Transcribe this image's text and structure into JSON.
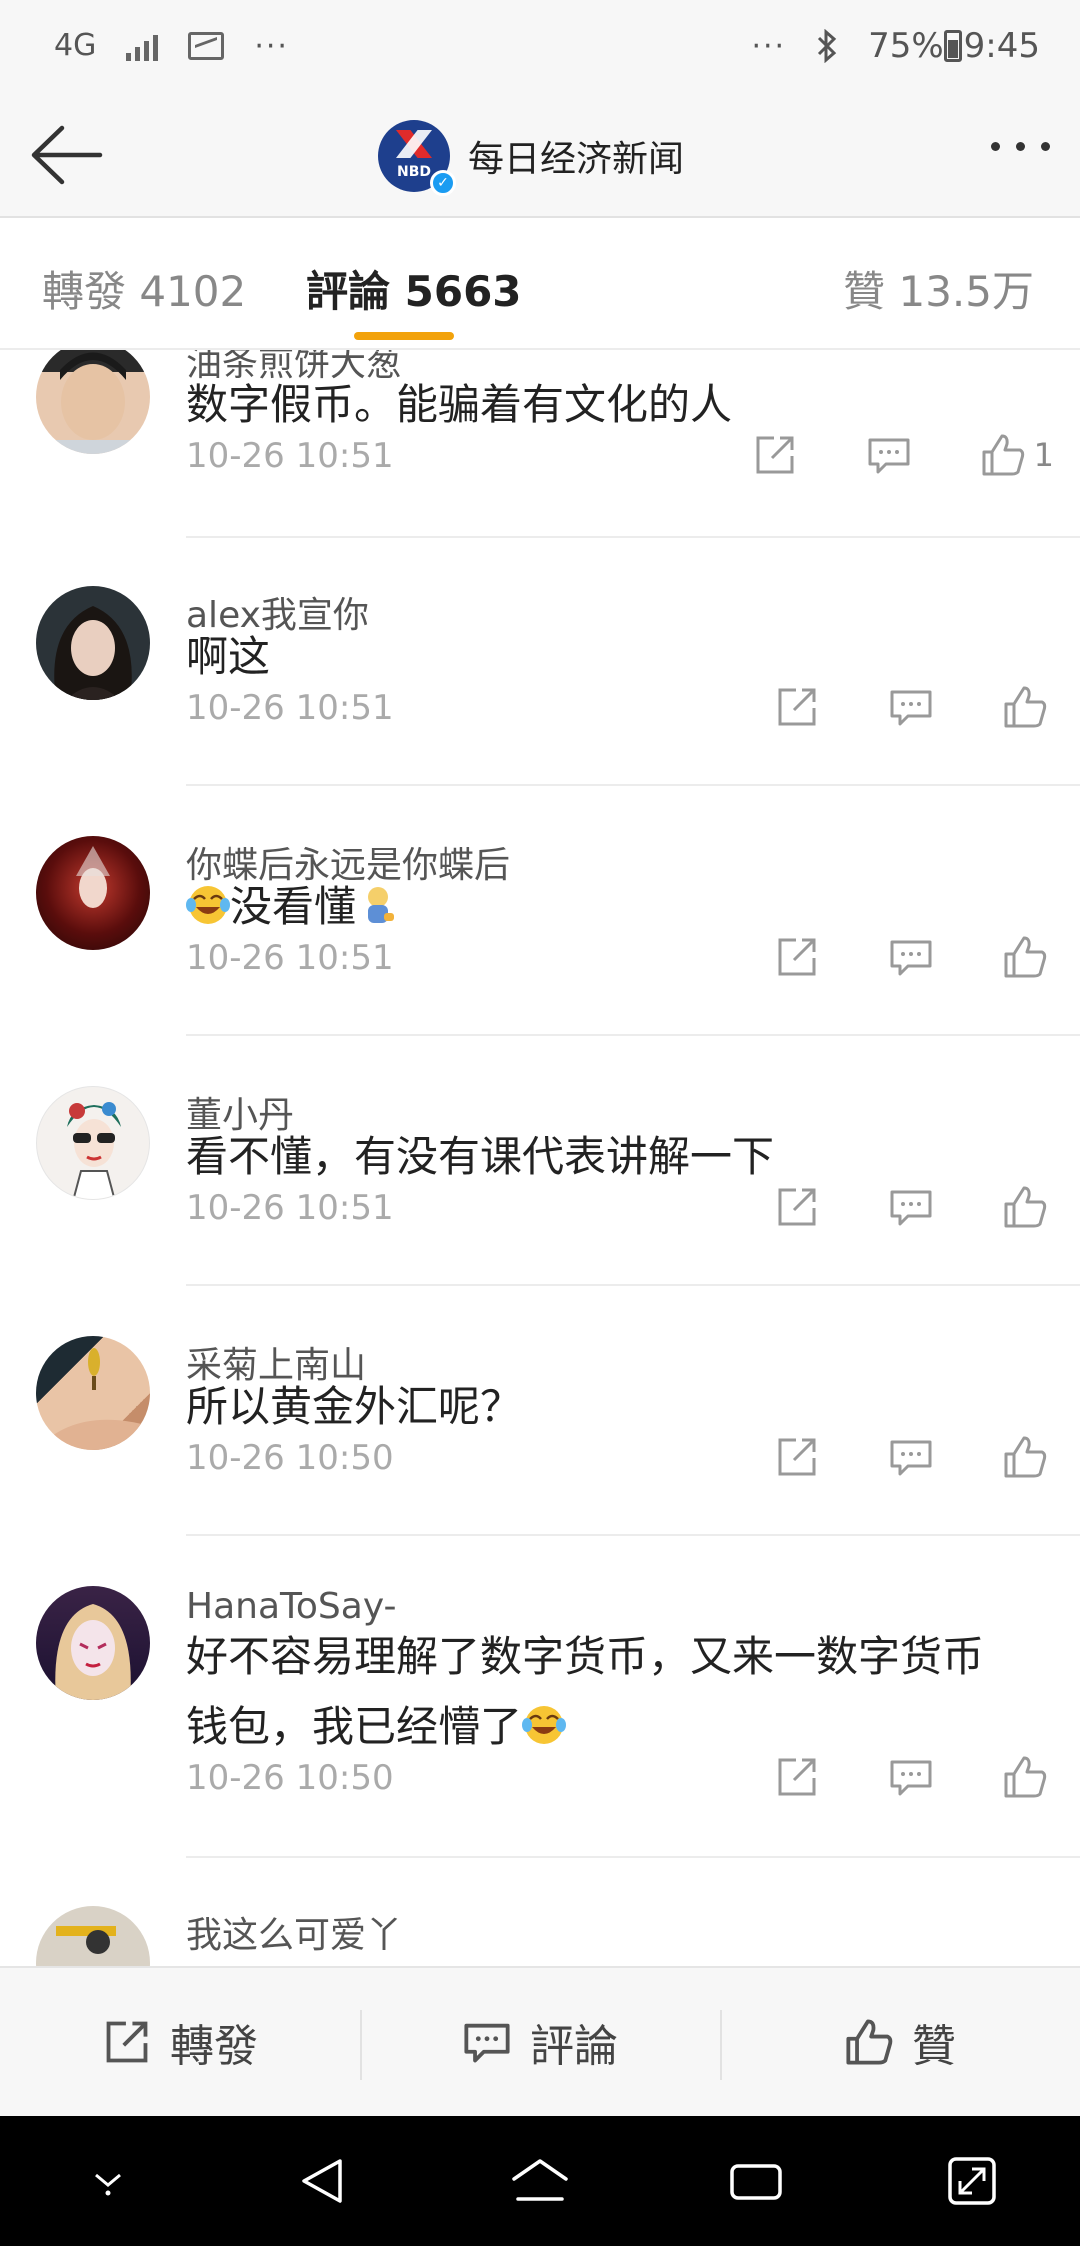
{
  "status_bar": {
    "network": "4G",
    "dots_left": "···",
    "dots_right": "···",
    "battery": "75%",
    "time": "9:45"
  },
  "header": {
    "logo_text": "NBD",
    "title": "每日经济新闻"
  },
  "tabs": {
    "repost": "轉發 4102",
    "comment": "評論 5663",
    "like": "贊 13.5万",
    "accent_color": "#f2a20b"
  },
  "comments": [
    {
      "user": "油条煎饼大葱",
      "text": "数字假币。能骗着有文化的人",
      "time": "10-26 10:51",
      "likes": "1"
    },
    {
      "user": "alex我宣你",
      "text": "啊这",
      "time": "10-26 10:51",
      "likes": ""
    },
    {
      "user": "你蝶后永远是你蝶后",
      "text": "没看懂",
      "time": "10-26 10:51",
      "likes": ""
    },
    {
      "user": "董小丹",
      "text": "看不懂，有没有课代表讲解一下",
      "time": "10-26 10:51",
      "likes": ""
    },
    {
      "user": "采菊上南山",
      "text": "所以黄金外汇呢？",
      "time": "10-26 10:50",
      "likes": ""
    },
    {
      "user": "HanaToSay-",
      "text_line1": "好不容易理解了数字货币，又来一数字货币",
      "text_line2": "钱包，我已经懵了",
      "time": "10-26 10:50",
      "likes": ""
    },
    {
      "user": "我这么可爱丫"
    }
  ],
  "bottom_bar": {
    "repost": "轉發",
    "comment": "評論",
    "like": "贊"
  }
}
